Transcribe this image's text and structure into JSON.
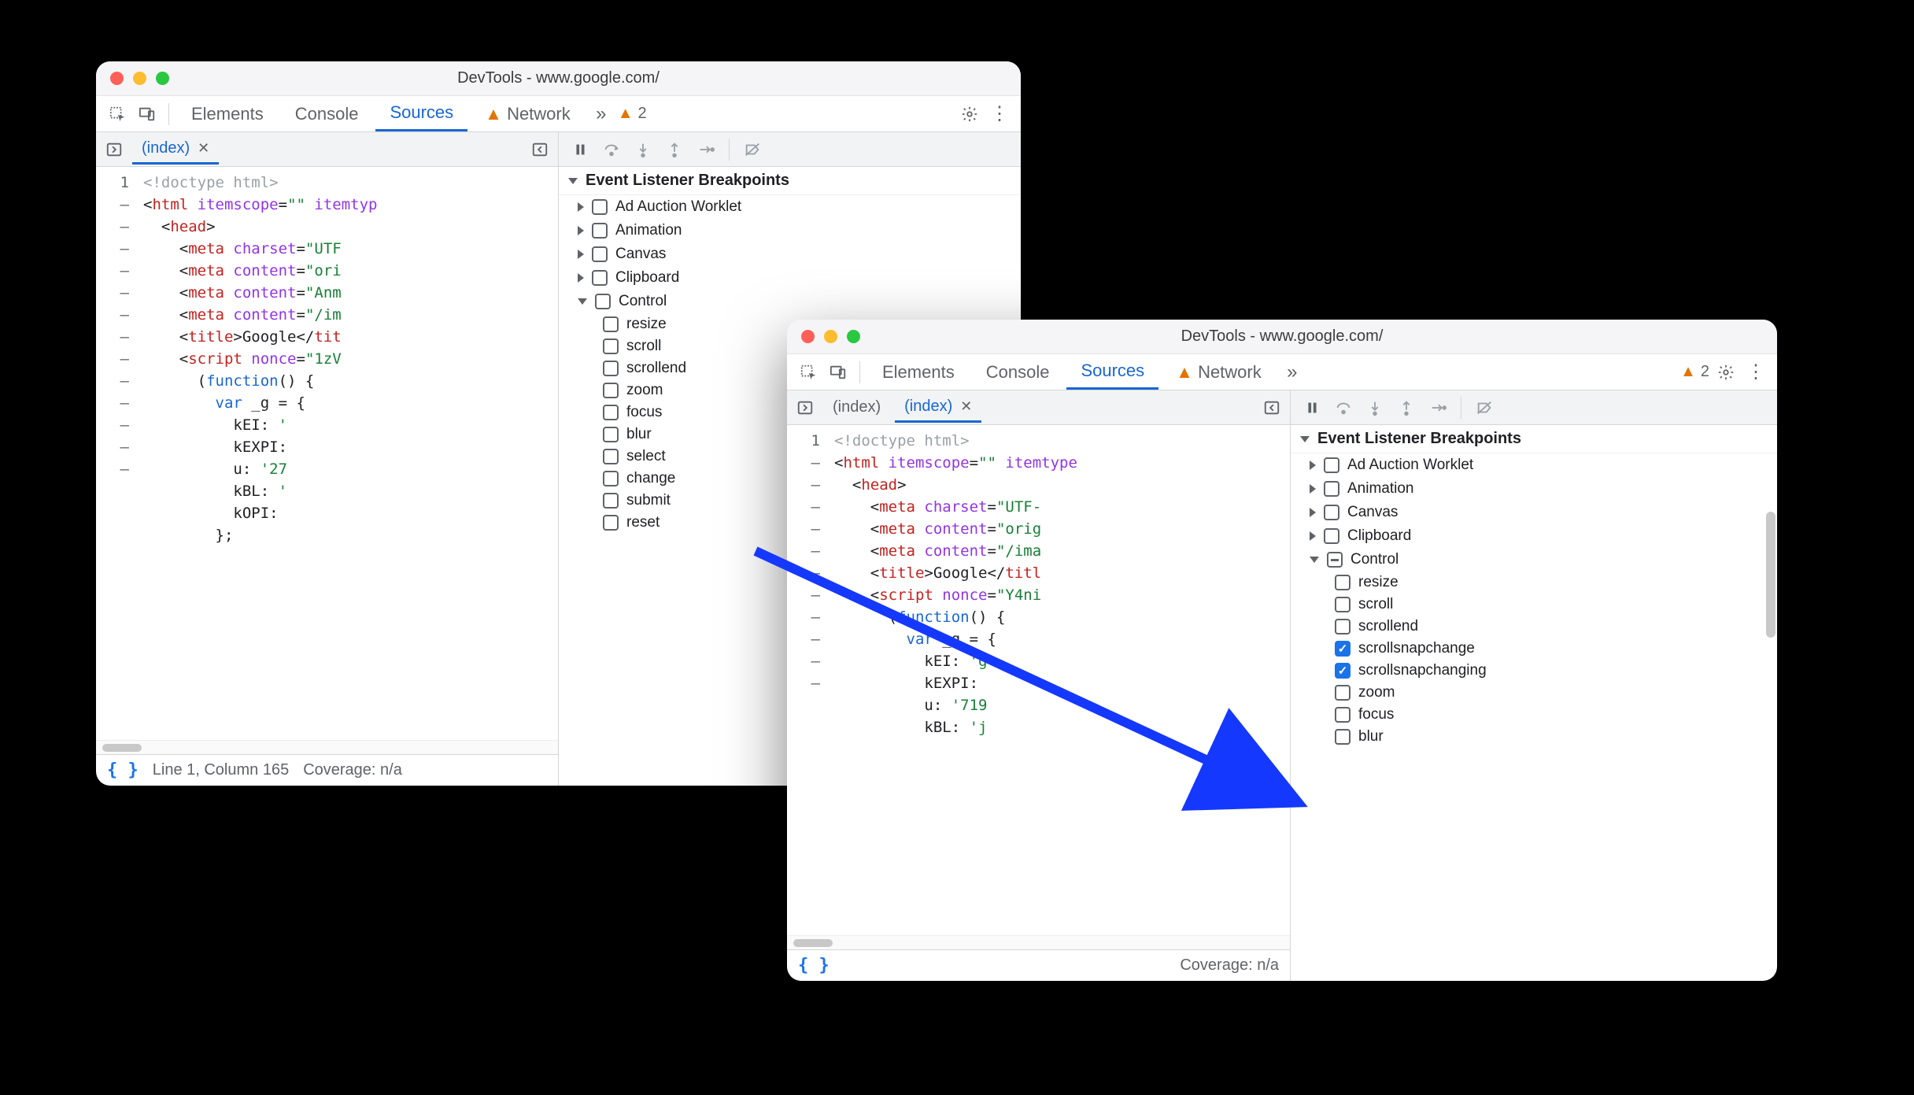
{
  "win1": {
    "title": "DevTools - www.google.com/",
    "tabs": [
      "Elements",
      "Console",
      "Sources",
      "Network"
    ],
    "active_tab": "Sources",
    "warn_count": "2",
    "file_tabs": [
      {
        "name": "(index)",
        "active": true
      }
    ],
    "gutter": [
      "1",
      "–",
      "–",
      "–",
      "–",
      "–",
      "–",
      "–",
      "–",
      "–",
      "–",
      "–",
      "–",
      "–"
    ],
    "status_pos": "Line 1, Column 165",
    "status_cov": "Coverage: n/a",
    "bp_header": "Event Listener Breakpoints",
    "cats": [
      {
        "name": "Ad Auction Worklet",
        "expanded": false
      },
      {
        "name": "Animation",
        "expanded": false
      },
      {
        "name": "Canvas",
        "expanded": false
      },
      {
        "name": "Clipboard",
        "expanded": false
      },
      {
        "name": "Control",
        "expanded": true,
        "subs": [
          {
            "name": "resize",
            "checked": false
          },
          {
            "name": "scroll",
            "checked": false
          },
          {
            "name": "scrollend",
            "checked": false
          },
          {
            "name": "zoom",
            "checked": false
          },
          {
            "name": "focus",
            "checked": false
          },
          {
            "name": "blur",
            "checked": false
          },
          {
            "name": "select",
            "checked": false
          },
          {
            "name": "change",
            "checked": false
          },
          {
            "name": "submit",
            "checked": false
          },
          {
            "name": "reset",
            "checked": false
          }
        ]
      }
    ],
    "code_lines": [
      [
        [
          "gray",
          "<!doctype html>"
        ]
      ],
      [
        [
          "black",
          "<"
        ],
        [
          "red",
          "html "
        ],
        [
          "purple",
          "itemscope"
        ],
        [
          "black",
          "="
        ],
        [
          "green",
          "\"\" "
        ],
        [
          "purple",
          "itemtyp"
        ]
      ],
      [
        [
          "black",
          "  <"
        ],
        [
          "red",
          "head"
        ],
        [
          "black",
          ">"
        ]
      ],
      [
        [
          "black",
          "    <"
        ],
        [
          "red",
          "meta "
        ],
        [
          "purple",
          "charset"
        ],
        [
          "black",
          "="
        ],
        [
          "green",
          "\"UTF"
        ]
      ],
      [
        [
          "black",
          "    <"
        ],
        [
          "red",
          "meta "
        ],
        [
          "purple",
          "content"
        ],
        [
          "black",
          "="
        ],
        [
          "green",
          "\"ori"
        ]
      ],
      [
        [
          "black",
          "    <"
        ],
        [
          "red",
          "meta "
        ],
        [
          "purple",
          "content"
        ],
        [
          "black",
          "="
        ],
        [
          "green",
          "\"Anm"
        ]
      ],
      [
        [
          "black",
          "    <"
        ],
        [
          "red",
          "meta "
        ],
        [
          "purple",
          "content"
        ],
        [
          "black",
          "="
        ],
        [
          "green",
          "\"/im"
        ]
      ],
      [
        [
          "black",
          "    <"
        ],
        [
          "red",
          "title"
        ],
        [
          "black",
          ">Google</"
        ],
        [
          "red",
          "tit"
        ]
      ],
      [
        [
          "black",
          "    <"
        ],
        [
          "red",
          "script "
        ],
        [
          "purple",
          "nonce"
        ],
        [
          "black",
          "="
        ],
        [
          "green",
          "\"1zV"
        ]
      ],
      [
        [
          "black",
          "      ("
        ],
        [
          "blue",
          "function"
        ],
        [
          "black",
          "() {"
        ]
      ],
      [
        [
          "black",
          "        "
        ],
        [
          "blue",
          "var"
        ],
        [
          "black",
          " _g = {"
        ]
      ],
      [
        [
          "black",
          "          kEI: "
        ],
        [
          "green",
          "'"
        ]
      ],
      [
        [
          "black",
          "          kEXPI:"
        ]
      ],
      [
        [
          "black",
          "          u: "
        ],
        [
          "green",
          "'27"
        ]
      ],
      [
        [
          "black",
          "          kBL: "
        ],
        [
          "green",
          "'"
        ]
      ],
      [
        [
          "black",
          "          kOPI:"
        ]
      ],
      [
        [
          "black",
          "        };"
        ]
      ]
    ]
  },
  "win2": {
    "title": "DevTools - www.google.com/",
    "tabs": [
      "Elements",
      "Console",
      "Sources",
      "Network"
    ],
    "active_tab": "Sources",
    "warn_count": "2",
    "file_tabs": [
      {
        "name": "(index)",
        "active": false
      },
      {
        "name": "(index)",
        "active": true
      }
    ],
    "gutter": [
      "1",
      "–",
      "–",
      "–",
      "–",
      "–",
      "–",
      "–",
      "–",
      "–",
      "–",
      "–"
    ],
    "status_cov": "Coverage: n/a",
    "bp_header": "Event Listener Breakpoints",
    "cats": [
      {
        "name": "Ad Auction Worklet",
        "expanded": false
      },
      {
        "name": "Animation",
        "expanded": false
      },
      {
        "name": "Canvas",
        "expanded": false
      },
      {
        "name": "Clipboard",
        "expanded": false
      },
      {
        "name": "Control",
        "expanded": true,
        "mixed": true,
        "subs": [
          {
            "name": "resize",
            "checked": false
          },
          {
            "name": "scroll",
            "checked": false
          },
          {
            "name": "scrollend",
            "checked": false
          },
          {
            "name": "scrollsnapchange",
            "checked": true
          },
          {
            "name": "scrollsnapchanging",
            "checked": true
          },
          {
            "name": "zoom",
            "checked": false
          },
          {
            "name": "focus",
            "checked": false
          },
          {
            "name": "blur",
            "checked": false
          }
        ]
      }
    ],
    "code_lines": [
      [
        [
          "gray",
          "<!doctype html>"
        ]
      ],
      [
        [
          "black",
          "<"
        ],
        [
          "red",
          "html "
        ],
        [
          "purple",
          "itemscope"
        ],
        [
          "black",
          "="
        ],
        [
          "green",
          "\"\" "
        ],
        [
          "purple",
          "itemtype"
        ]
      ],
      [
        [
          "black",
          "  <"
        ],
        [
          "red",
          "head"
        ],
        [
          "black",
          ">"
        ]
      ],
      [
        [
          "black",
          "    <"
        ],
        [
          "red",
          "meta "
        ],
        [
          "purple",
          "charset"
        ],
        [
          "black",
          "="
        ],
        [
          "green",
          "\"UTF-"
        ]
      ],
      [
        [
          "black",
          "    <"
        ],
        [
          "red",
          "meta "
        ],
        [
          "purple",
          "content"
        ],
        [
          "black",
          "="
        ],
        [
          "green",
          "\"orig"
        ]
      ],
      [
        [
          "black",
          "    <"
        ],
        [
          "red",
          "meta "
        ],
        [
          "purple",
          "content"
        ],
        [
          "black",
          "="
        ],
        [
          "green",
          "\"/ima"
        ]
      ],
      [
        [
          "black",
          "    <"
        ],
        [
          "red",
          "title"
        ],
        [
          "black",
          ">Google</"
        ],
        [
          "red",
          "titl"
        ]
      ],
      [
        [
          "black",
          "    <"
        ],
        [
          "red",
          "script "
        ],
        [
          "purple",
          "nonce"
        ],
        [
          "black",
          "="
        ],
        [
          "green",
          "\"Y4ni"
        ]
      ],
      [
        [
          "black",
          "      ("
        ],
        [
          "blue",
          "function"
        ],
        [
          "black",
          "() {"
        ]
      ],
      [
        [
          "black",
          "        "
        ],
        [
          "blue",
          "var"
        ],
        [
          "black",
          " _g = {"
        ]
      ],
      [
        [
          "black",
          "          kEI: "
        ],
        [
          "green",
          "'g"
        ]
      ],
      [
        [
          "black",
          "          kEXPI:"
        ]
      ],
      [
        [
          "black",
          "          u: "
        ],
        [
          "green",
          "'719"
        ]
      ],
      [
        [
          "black",
          "          kBL: "
        ],
        [
          "green",
          "'j"
        ]
      ]
    ]
  }
}
